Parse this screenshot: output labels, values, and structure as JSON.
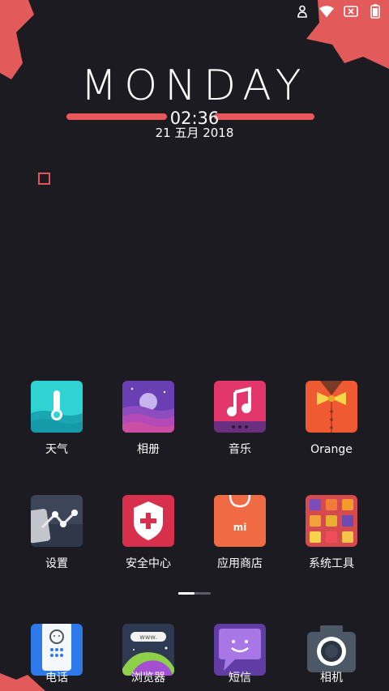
{
  "status_bar": {
    "icons": [
      "person-icon",
      "wifi-icon",
      "sim-off-icon",
      "battery-icon"
    ]
  },
  "clock": {
    "day": "MONDAY",
    "time": "02:36",
    "date": "21 五月 2018"
  },
  "apps": {
    "row1": [
      {
        "label": "天气",
        "icon": "weather-icon"
      },
      {
        "label": "相册",
        "icon": "gallery-icon"
      },
      {
        "label": "音乐",
        "icon": "music-icon"
      },
      {
        "label": "Orange",
        "icon": "orange-theme-icon"
      }
    ],
    "row2": [
      {
        "label": "设置",
        "icon": "settings-icon"
      },
      {
        "label": "安全中心",
        "icon": "security-icon"
      },
      {
        "label": "应用商店",
        "icon": "app-store-icon"
      },
      {
        "label": "系统工具",
        "icon": "system-tools-folder-icon"
      }
    ]
  },
  "dock": [
    {
      "label": "电话",
      "icon": "phone-icon"
    },
    {
      "label": "浏览器",
      "icon": "browser-icon"
    },
    {
      "label": "短信",
      "icon": "messages-icon"
    },
    {
      "label": "相机",
      "icon": "camera-icon"
    }
  ],
  "page_indicator": {
    "pages": 2,
    "current": 1
  },
  "colors": {
    "background": "#1b1b21",
    "accent": "#e8575a"
  }
}
